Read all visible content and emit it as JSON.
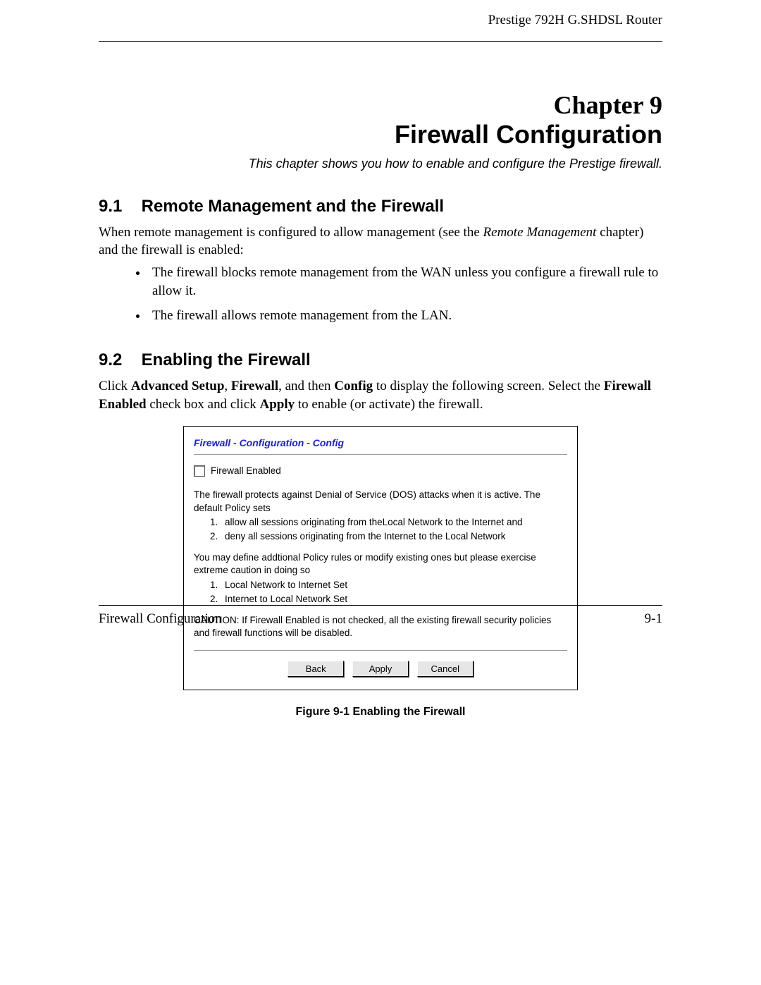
{
  "header": {
    "product": "Prestige 792H G.SHDSL Router"
  },
  "chapter": {
    "line1": "Chapter 9",
    "line2": "Firewall Configuration",
    "subtitle": "This chapter shows you how to enable and configure the Prestige firewall."
  },
  "section91": {
    "num": "9.1",
    "title": "Remote Management and the Firewall",
    "para_pre": "When remote management is configured to allow management (see the ",
    "para_em": "Remote Management",
    "para_post": " chapter) and the firewall is enabled:",
    "bullets": [
      "The firewall blocks remote management from the WAN unless you configure a firewall rule to allow it.",
      "The firewall allows remote management from the LAN."
    ]
  },
  "section92": {
    "num": "9.2",
    "title": "Enabling the Firewall",
    "para": {
      "t1": "Click ",
      "b1": "Advanced Setup",
      "t2": ", ",
      "b2": "Firewall",
      "t3": ", and then ",
      "b3": "Config",
      "t4": " to display the following screen. Select the ",
      "b4": "Firewall Enabled",
      "t5": " check box and click ",
      "b5": "Apply",
      "t6": " to enable (or activate) the firewall."
    }
  },
  "panel": {
    "title": "Firewall - Configuration - Config",
    "checkbox_label": "Firewall Enabled",
    "p1": "The firewall protects against Denial of Service (DOS) attacks when it is active. The default Policy sets",
    "ol1": [
      "allow all sessions originating from theLocal Network to the Internet and",
      "deny all sessions originating from the Internet to the Local Network"
    ],
    "p2": "You may define addtional Policy rules or modify existing ones but please exercise extreme caution in doing so",
    "ol2": [
      "Local Network to Internet Set",
      "Internet to Local Network Set"
    ],
    "p3": "CAUTION: If Firewall Enabled is not checked, all the existing firewall security policies and firewall functions will be disabled.",
    "buttons": {
      "back": "Back",
      "apply": "Apply",
      "cancel": "Cancel"
    }
  },
  "figure_caption": "Figure 9-1 Enabling the Firewall",
  "footer": {
    "left": "Firewall Configuration",
    "right": "9-1"
  }
}
